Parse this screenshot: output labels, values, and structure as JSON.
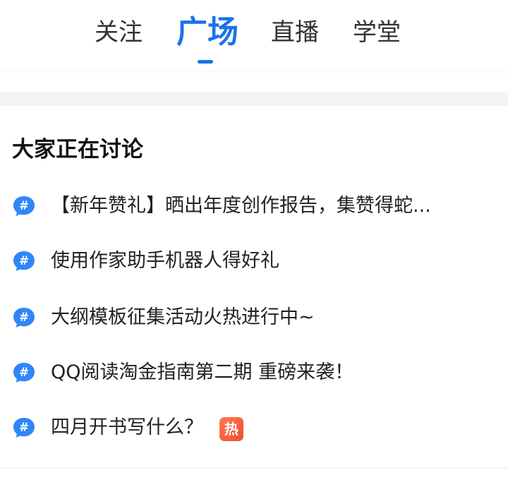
{
  "nav": {
    "tabs": [
      {
        "label": "关注"
      },
      {
        "label": "广场"
      },
      {
        "label": "直播"
      },
      {
        "label": "学堂"
      }
    ],
    "active_tab": "广场",
    "accent_color": "#1a73e8"
  },
  "discussion": {
    "title": "大家正在讨论",
    "items": [
      {
        "icon": "hashtag-chat-icon",
        "text": "【新年赞礼】晒出年度创作报告，集赞得蛇..."
      },
      {
        "icon": "hashtag-chat-icon",
        "text": "使用作家助手机器人得好礼"
      },
      {
        "icon": "hashtag-chat-icon",
        "text": "大纲模板征集活动火热进行中~"
      },
      {
        "icon": "hashtag-chat-icon",
        "text": "QQ阅读淘金指南第二期 重磅来袭！"
      },
      {
        "icon": "hashtag-chat-icon",
        "text": "四月开书写什么？",
        "badge": "热"
      }
    ],
    "hot_badge_color": "#f04d2f"
  }
}
